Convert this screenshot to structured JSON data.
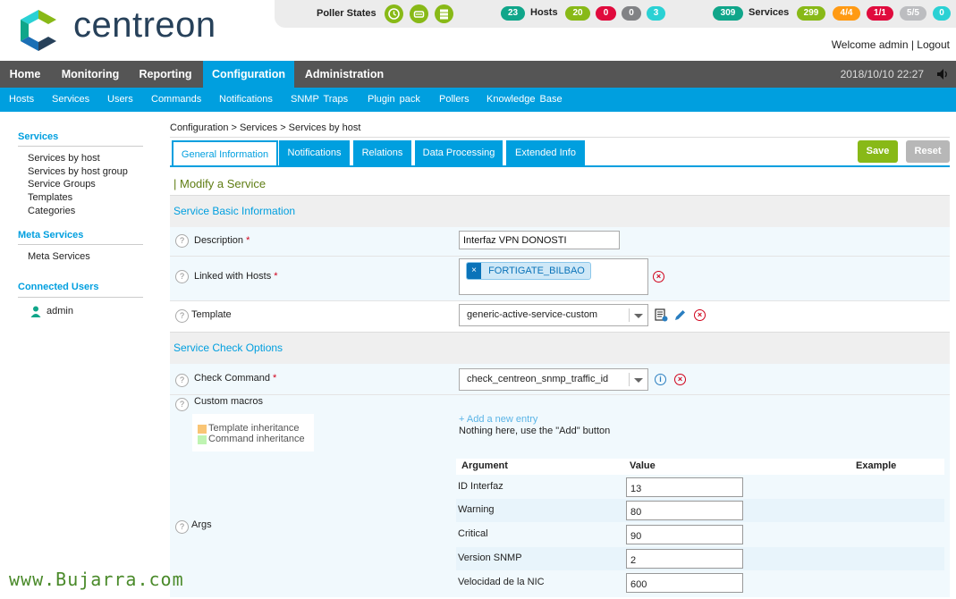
{
  "header": {
    "logo_text": "centreon",
    "welcome": "Welcome admin | Logout",
    "poller_label": "Poller States",
    "hosts_label": "Hosts",
    "services_label": "Services",
    "hosts_counts": [
      "23",
      "20",
      "0",
      "0",
      "3"
    ],
    "services_counts": [
      "309",
      "299",
      "4/4",
      "1/1",
      "5/5",
      "0"
    ],
    "colors": {
      "green": "#88b917",
      "red": "#e00b3d",
      "gray": "#818285",
      "cyan": "#2ad1d4",
      "teal": "#10a68a",
      "orange": "#ff9a13",
      "accent": "#009fdf"
    }
  },
  "mainnav": {
    "items": [
      "Home",
      "Monitoring",
      "Reporting",
      "Configuration",
      "Administration"
    ],
    "active": "Configuration",
    "datetime": "2018/10/10 22:27"
  },
  "subnav": {
    "items": [
      "Hosts",
      "Services",
      "Users",
      "Commands",
      "Notifications",
      "SNMP  Traps",
      "Plugin  pack",
      "Pollers",
      "Knowledge  Base"
    ]
  },
  "sidebar": {
    "sections": [
      {
        "title": "Services",
        "items": [
          "Services by host",
          "Services by host group",
          "Service Groups",
          "Templates",
          "Categories"
        ]
      },
      {
        "title": "Meta Services",
        "items": [
          "Meta Services"
        ]
      },
      {
        "title": "Connected Users",
        "items": [
          "admin"
        ]
      }
    ]
  },
  "breadcrumb": "Configuration  >  Services  >  Services by host",
  "tabs": [
    "General Information",
    "Notifications",
    "Relations",
    "Data Processing",
    "Extended Info"
  ],
  "buttons": {
    "save": "Save",
    "reset": "Reset"
  },
  "form": {
    "title": "| Modify a Service",
    "section_basic": "Service Basic Information",
    "section_check": "Service Check Options",
    "description_label": "Description",
    "description_value": "Interfaz VPN DONOSTI",
    "linked_hosts_label": "Linked with Hosts",
    "linked_host_tag": "FORTIGATE_BILBAO",
    "template_label": "Template",
    "template_value": "generic-active-service-custom",
    "check_command_label": "Check Command",
    "check_command_value": "check_centreon_snmp_traffic_id",
    "custom_macros_label": "Custom macros",
    "legend_template": "Template inheritance",
    "legend_command": "Command inheritance",
    "add_entry": "+ Add a new entry",
    "nothing_here": "Nothing here, use the \"Add\" button",
    "args_label": "Args",
    "args_headers": {
      "argument": "Argument",
      "value": "Value",
      "example": "Example"
    },
    "args": [
      {
        "name": "ID Interfaz",
        "value": "13"
      },
      {
        "name": "Warning",
        "value": "80"
      },
      {
        "name": "Critical",
        "value": "90"
      },
      {
        "name": "Version SNMP",
        "value": "2"
      },
      {
        "name": "Velocidad de la NIC",
        "value": "600"
      }
    ]
  },
  "watermark": "www.Bujarra.com"
}
